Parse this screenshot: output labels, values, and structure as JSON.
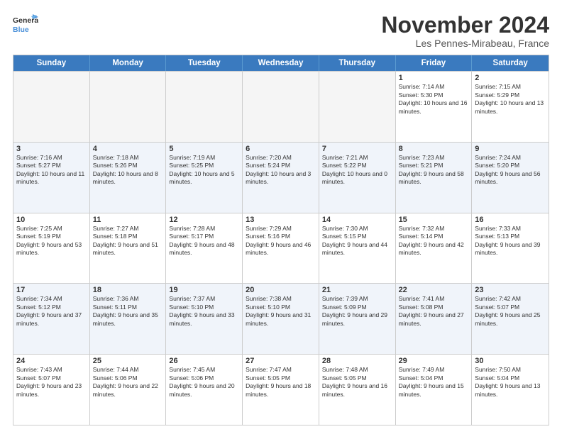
{
  "logo": {
    "line1": "General",
    "line2": "Blue"
  },
  "title": "November 2024",
  "location": "Les Pennes-Mirabeau, France",
  "header_days": [
    "Sunday",
    "Monday",
    "Tuesday",
    "Wednesday",
    "Thursday",
    "Friday",
    "Saturday"
  ],
  "weeks": [
    [
      {
        "day": "",
        "empty": true
      },
      {
        "day": "",
        "empty": true
      },
      {
        "day": "",
        "empty": true
      },
      {
        "day": "",
        "empty": true
      },
      {
        "day": "",
        "empty": true
      },
      {
        "day": "1",
        "info": "Sunrise: 7:14 AM\nSunset: 5:30 PM\nDaylight: 10 hours and 16 minutes."
      },
      {
        "day": "2",
        "info": "Sunrise: 7:15 AM\nSunset: 5:29 PM\nDaylight: 10 hours and 13 minutes."
      }
    ],
    [
      {
        "day": "3",
        "info": "Sunrise: 7:16 AM\nSunset: 5:27 PM\nDaylight: 10 hours and 11 minutes."
      },
      {
        "day": "4",
        "info": "Sunrise: 7:18 AM\nSunset: 5:26 PM\nDaylight: 10 hours and 8 minutes."
      },
      {
        "day": "5",
        "info": "Sunrise: 7:19 AM\nSunset: 5:25 PM\nDaylight: 10 hours and 5 minutes."
      },
      {
        "day": "6",
        "info": "Sunrise: 7:20 AM\nSunset: 5:24 PM\nDaylight: 10 hours and 3 minutes."
      },
      {
        "day": "7",
        "info": "Sunrise: 7:21 AM\nSunset: 5:22 PM\nDaylight: 10 hours and 0 minutes."
      },
      {
        "day": "8",
        "info": "Sunrise: 7:23 AM\nSunset: 5:21 PM\nDaylight: 9 hours and 58 minutes."
      },
      {
        "day": "9",
        "info": "Sunrise: 7:24 AM\nSunset: 5:20 PM\nDaylight: 9 hours and 56 minutes."
      }
    ],
    [
      {
        "day": "10",
        "info": "Sunrise: 7:25 AM\nSunset: 5:19 PM\nDaylight: 9 hours and 53 minutes."
      },
      {
        "day": "11",
        "info": "Sunrise: 7:27 AM\nSunset: 5:18 PM\nDaylight: 9 hours and 51 minutes."
      },
      {
        "day": "12",
        "info": "Sunrise: 7:28 AM\nSunset: 5:17 PM\nDaylight: 9 hours and 48 minutes."
      },
      {
        "day": "13",
        "info": "Sunrise: 7:29 AM\nSunset: 5:16 PM\nDaylight: 9 hours and 46 minutes."
      },
      {
        "day": "14",
        "info": "Sunrise: 7:30 AM\nSunset: 5:15 PM\nDaylight: 9 hours and 44 minutes."
      },
      {
        "day": "15",
        "info": "Sunrise: 7:32 AM\nSunset: 5:14 PM\nDaylight: 9 hours and 42 minutes."
      },
      {
        "day": "16",
        "info": "Sunrise: 7:33 AM\nSunset: 5:13 PM\nDaylight: 9 hours and 39 minutes."
      }
    ],
    [
      {
        "day": "17",
        "info": "Sunrise: 7:34 AM\nSunset: 5:12 PM\nDaylight: 9 hours and 37 minutes."
      },
      {
        "day": "18",
        "info": "Sunrise: 7:36 AM\nSunset: 5:11 PM\nDaylight: 9 hours and 35 minutes."
      },
      {
        "day": "19",
        "info": "Sunrise: 7:37 AM\nSunset: 5:10 PM\nDaylight: 9 hours and 33 minutes."
      },
      {
        "day": "20",
        "info": "Sunrise: 7:38 AM\nSunset: 5:10 PM\nDaylight: 9 hours and 31 minutes."
      },
      {
        "day": "21",
        "info": "Sunrise: 7:39 AM\nSunset: 5:09 PM\nDaylight: 9 hours and 29 minutes."
      },
      {
        "day": "22",
        "info": "Sunrise: 7:41 AM\nSunset: 5:08 PM\nDaylight: 9 hours and 27 minutes."
      },
      {
        "day": "23",
        "info": "Sunrise: 7:42 AM\nSunset: 5:07 PM\nDaylight: 9 hours and 25 minutes."
      }
    ],
    [
      {
        "day": "24",
        "info": "Sunrise: 7:43 AM\nSunset: 5:07 PM\nDaylight: 9 hours and 23 minutes."
      },
      {
        "day": "25",
        "info": "Sunrise: 7:44 AM\nSunset: 5:06 PM\nDaylight: 9 hours and 22 minutes."
      },
      {
        "day": "26",
        "info": "Sunrise: 7:45 AM\nSunset: 5:06 PM\nDaylight: 9 hours and 20 minutes."
      },
      {
        "day": "27",
        "info": "Sunrise: 7:47 AM\nSunset: 5:05 PM\nDaylight: 9 hours and 18 minutes."
      },
      {
        "day": "28",
        "info": "Sunrise: 7:48 AM\nSunset: 5:05 PM\nDaylight: 9 hours and 16 minutes."
      },
      {
        "day": "29",
        "info": "Sunrise: 7:49 AM\nSunset: 5:04 PM\nDaylight: 9 hours and 15 minutes."
      },
      {
        "day": "30",
        "info": "Sunrise: 7:50 AM\nSunset: 5:04 PM\nDaylight: 9 hours and 13 minutes."
      }
    ]
  ]
}
